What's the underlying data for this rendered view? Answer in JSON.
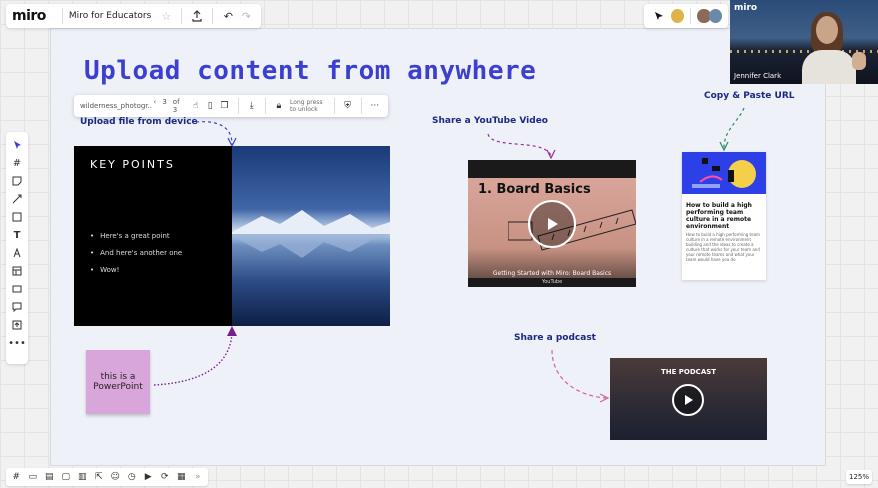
{
  "app": {
    "logo": "miro",
    "board_name": "Miro for Educators"
  },
  "frame": {
    "title": "Upload content from anywhere"
  },
  "video_tile": {
    "logo": "miro",
    "participant_name": "Jennifer Clark"
  },
  "context_toolbar": {
    "file_name": "wilderness_photogr...",
    "page_current": "3",
    "page_total": "of 3",
    "lock_text": "Long press to unlock"
  },
  "labels": {
    "upload": "Upload file from device",
    "youtube": "Share a YouTube Video",
    "copy_paste": "Copy & Paste URL",
    "podcast": "Share a podcast"
  },
  "slide": {
    "title": "KEY POINTS",
    "bullets": [
      "Here's a great point",
      "And here's another one",
      "Wow!"
    ]
  },
  "sticky": {
    "text": "this is a PowerPoint"
  },
  "youtube_card": {
    "title": "1. Board Basics",
    "caption": "Getting Started with Miro: Board Basics",
    "source": "YouTube"
  },
  "article": {
    "title": "How to build a high performing team culture in a remote environment",
    "body": "How to build a high performing team culture in a remote environment building and the ideas to create a culture that works for your team and your remote teams and what your team would have you do"
  },
  "podcast": {
    "title": "THE PODCAST"
  },
  "zoom": {
    "level": "125%"
  },
  "colors": {
    "accent": "#3c3fd0",
    "sticky": "#d9a6db",
    "label": "#1b2a80"
  }
}
